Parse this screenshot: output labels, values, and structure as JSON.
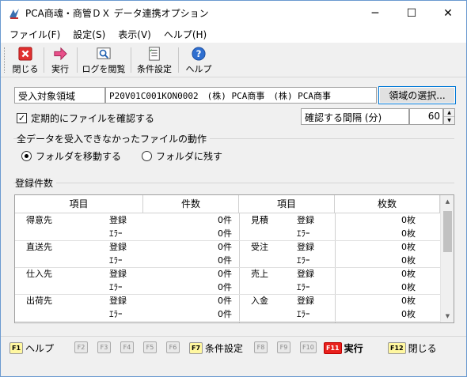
{
  "window": {
    "title": "PCA商魂・商管ＤＸ データ連携オプション",
    "minimize": "─",
    "maximize": "☐",
    "close": "✕"
  },
  "menu": [
    "ファイル(F)",
    "設定(S)",
    "表示(V)",
    "ヘルプ(H)"
  ],
  "toolbar": {
    "close_label": "閉じる",
    "run_label": "実行",
    "log_label": "ログを閲覧",
    "condition_label": "条件設定",
    "help_label": "ヘルプ"
  },
  "form": {
    "area_label": "受入対象領域",
    "area_value": "P20V01C001KON0002　(株) PCA商事　(株) PCA商事",
    "select_button": "領域の選択...",
    "periodic_check_label": "定期的にファイルを確認する",
    "periodic_checked": true,
    "interval_label": "確認する間隔 (分)",
    "interval_value": "60",
    "failure_group_title": "全データを受入できなかったファイルの動作",
    "radio_move": "フォルダを移動する",
    "radio_keep": "フォルダに残す",
    "selected_radio": "move"
  },
  "counts": {
    "title": "登録件数",
    "headers": [
      "項目",
      "件数",
      "項目",
      "枚数"
    ],
    "rows": [
      {
        "left_item": "得意先",
        "left_type": "登録",
        "left_count": "0件",
        "right_item": "見積",
        "right_type": "登録",
        "right_count": "0枚"
      },
      {
        "left_item": "",
        "left_type": "ｴﾗｰ",
        "left_count": "0件",
        "right_item": "",
        "right_type": "ｴﾗｰ",
        "right_count": "0枚"
      },
      {
        "left_item": "直送先",
        "left_type": "登録",
        "left_count": "0件",
        "right_item": "受注",
        "right_type": "登録",
        "right_count": "0枚"
      },
      {
        "left_item": "",
        "left_type": "ｴﾗｰ",
        "left_count": "0件",
        "right_item": "",
        "right_type": "ｴﾗｰ",
        "right_count": "0枚"
      },
      {
        "left_item": "仕入先",
        "left_type": "登録",
        "left_count": "0件",
        "right_item": "売上",
        "right_type": "登録",
        "right_count": "0枚"
      },
      {
        "left_item": "",
        "left_type": "ｴﾗｰ",
        "left_count": "0件",
        "right_item": "",
        "right_type": "ｴﾗｰ",
        "right_count": "0枚"
      },
      {
        "left_item": "出荷先",
        "left_type": "登録",
        "left_count": "0件",
        "right_item": "入金",
        "right_type": "登録",
        "right_count": "0枚"
      },
      {
        "left_item": "",
        "left_type": "ｴﾗｰ",
        "left_count": "0件",
        "right_item": "",
        "right_type": "ｴﾗｰ",
        "right_count": "0枚"
      }
    ]
  },
  "fkeys": [
    {
      "key": "F1",
      "label": "ヘルプ",
      "active": true
    },
    {
      "key": "F2",
      "label": "",
      "active": false
    },
    {
      "key": "F3",
      "label": "",
      "active": false
    },
    {
      "key": "F4",
      "label": "",
      "active": false
    },
    {
      "key": "F5",
      "label": "",
      "active": false
    },
    {
      "key": "F6",
      "label": "",
      "active": false
    },
    {
      "key": "F7",
      "label": "条件設定",
      "active": true
    },
    {
      "key": "F8",
      "label": "",
      "active": false
    },
    {
      "key": "F9",
      "label": "",
      "active": false
    },
    {
      "key": "F10",
      "label": "",
      "active": false
    },
    {
      "key": "F11",
      "label": "実行",
      "active": true
    },
    {
      "key": "F12",
      "label": "閉じる",
      "active": true
    }
  ],
  "colors": {
    "accent_border": "#0078d7",
    "fkey_active": "#fff7a0",
    "fkey_run": "#e8201c"
  }
}
